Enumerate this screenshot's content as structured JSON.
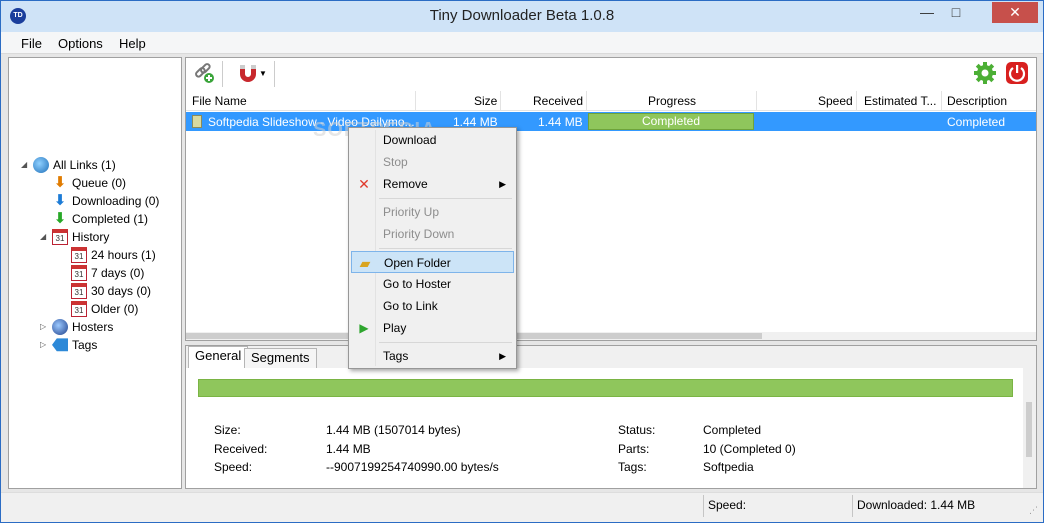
{
  "window": {
    "title": "Tiny Downloader Beta 1.0.8",
    "app_icon": "TD",
    "min_glyph": "—",
    "max_glyph": "□",
    "close_glyph": "✕"
  },
  "menu": [
    "File",
    "Options",
    "Help"
  ],
  "tree": {
    "all_links": "All Links (1)",
    "queue": "Queue (0)",
    "downloading": "Downloading (0)",
    "completed": "Completed (1)",
    "history": "History",
    "h24": "24 hours (1)",
    "d7": "7 days (0)",
    "d30": "30 days (0)",
    "older": "Older (0)",
    "hosters": "Hosters",
    "tags": "Tags",
    "calendar_day": "31"
  },
  "toolbar": {
    "add_link_icon": "link-add-icon",
    "magnet_icon": "magnet-icon",
    "settings_icon": "gear-icon",
    "power_icon": "power-icon"
  },
  "grid": {
    "columns": [
      "File Name",
      "Size",
      "Received",
      "Progress",
      "Speed",
      "Estimated T...",
      "Description"
    ],
    "rows": [
      {
        "file_name": "Softpedia Slideshow - Video Dailymo...",
        "size": "1.44 MB",
        "received": "1.44 MB",
        "progress": "Completed",
        "progress_value": 1.0,
        "speed": "",
        "estimated": "",
        "description": "Completed"
      }
    ]
  },
  "context_menu": {
    "download": "Download",
    "stop": "Stop",
    "remove": "Remove",
    "priority_up": "Priority Up",
    "priority_down": "Priority Down",
    "open_folder": "Open Folder",
    "go_hoster": "Go to Hoster",
    "go_link": "Go to Link",
    "play": "Play",
    "tags": "Tags"
  },
  "details": {
    "tabs": [
      "General",
      "Segments"
    ],
    "progress_value": 1.0,
    "size_label": "Size:",
    "size_value": "1.44 MB (1507014 bytes)",
    "received_label": "Received:",
    "received_value": "1.44 MB",
    "speed_label": "Speed:",
    "speed_value": "--9007199254740990.00 bytes/s",
    "status_label": "Status:",
    "status_value": "Completed",
    "parts_label": "Parts:",
    "parts_value": "10 (Completed 0)",
    "tags_label": "Tags:",
    "tags_value": "Softpedia"
  },
  "status": {
    "speed": "Speed:",
    "downloaded": "Downloaded: 1.44 MB"
  },
  "watermark": "SOFTPEDIA",
  "colors": {
    "selection": "#3399ff",
    "progress": "#8fc65c",
    "menu_hover": "#cce4f7",
    "close": "#c7504b"
  }
}
